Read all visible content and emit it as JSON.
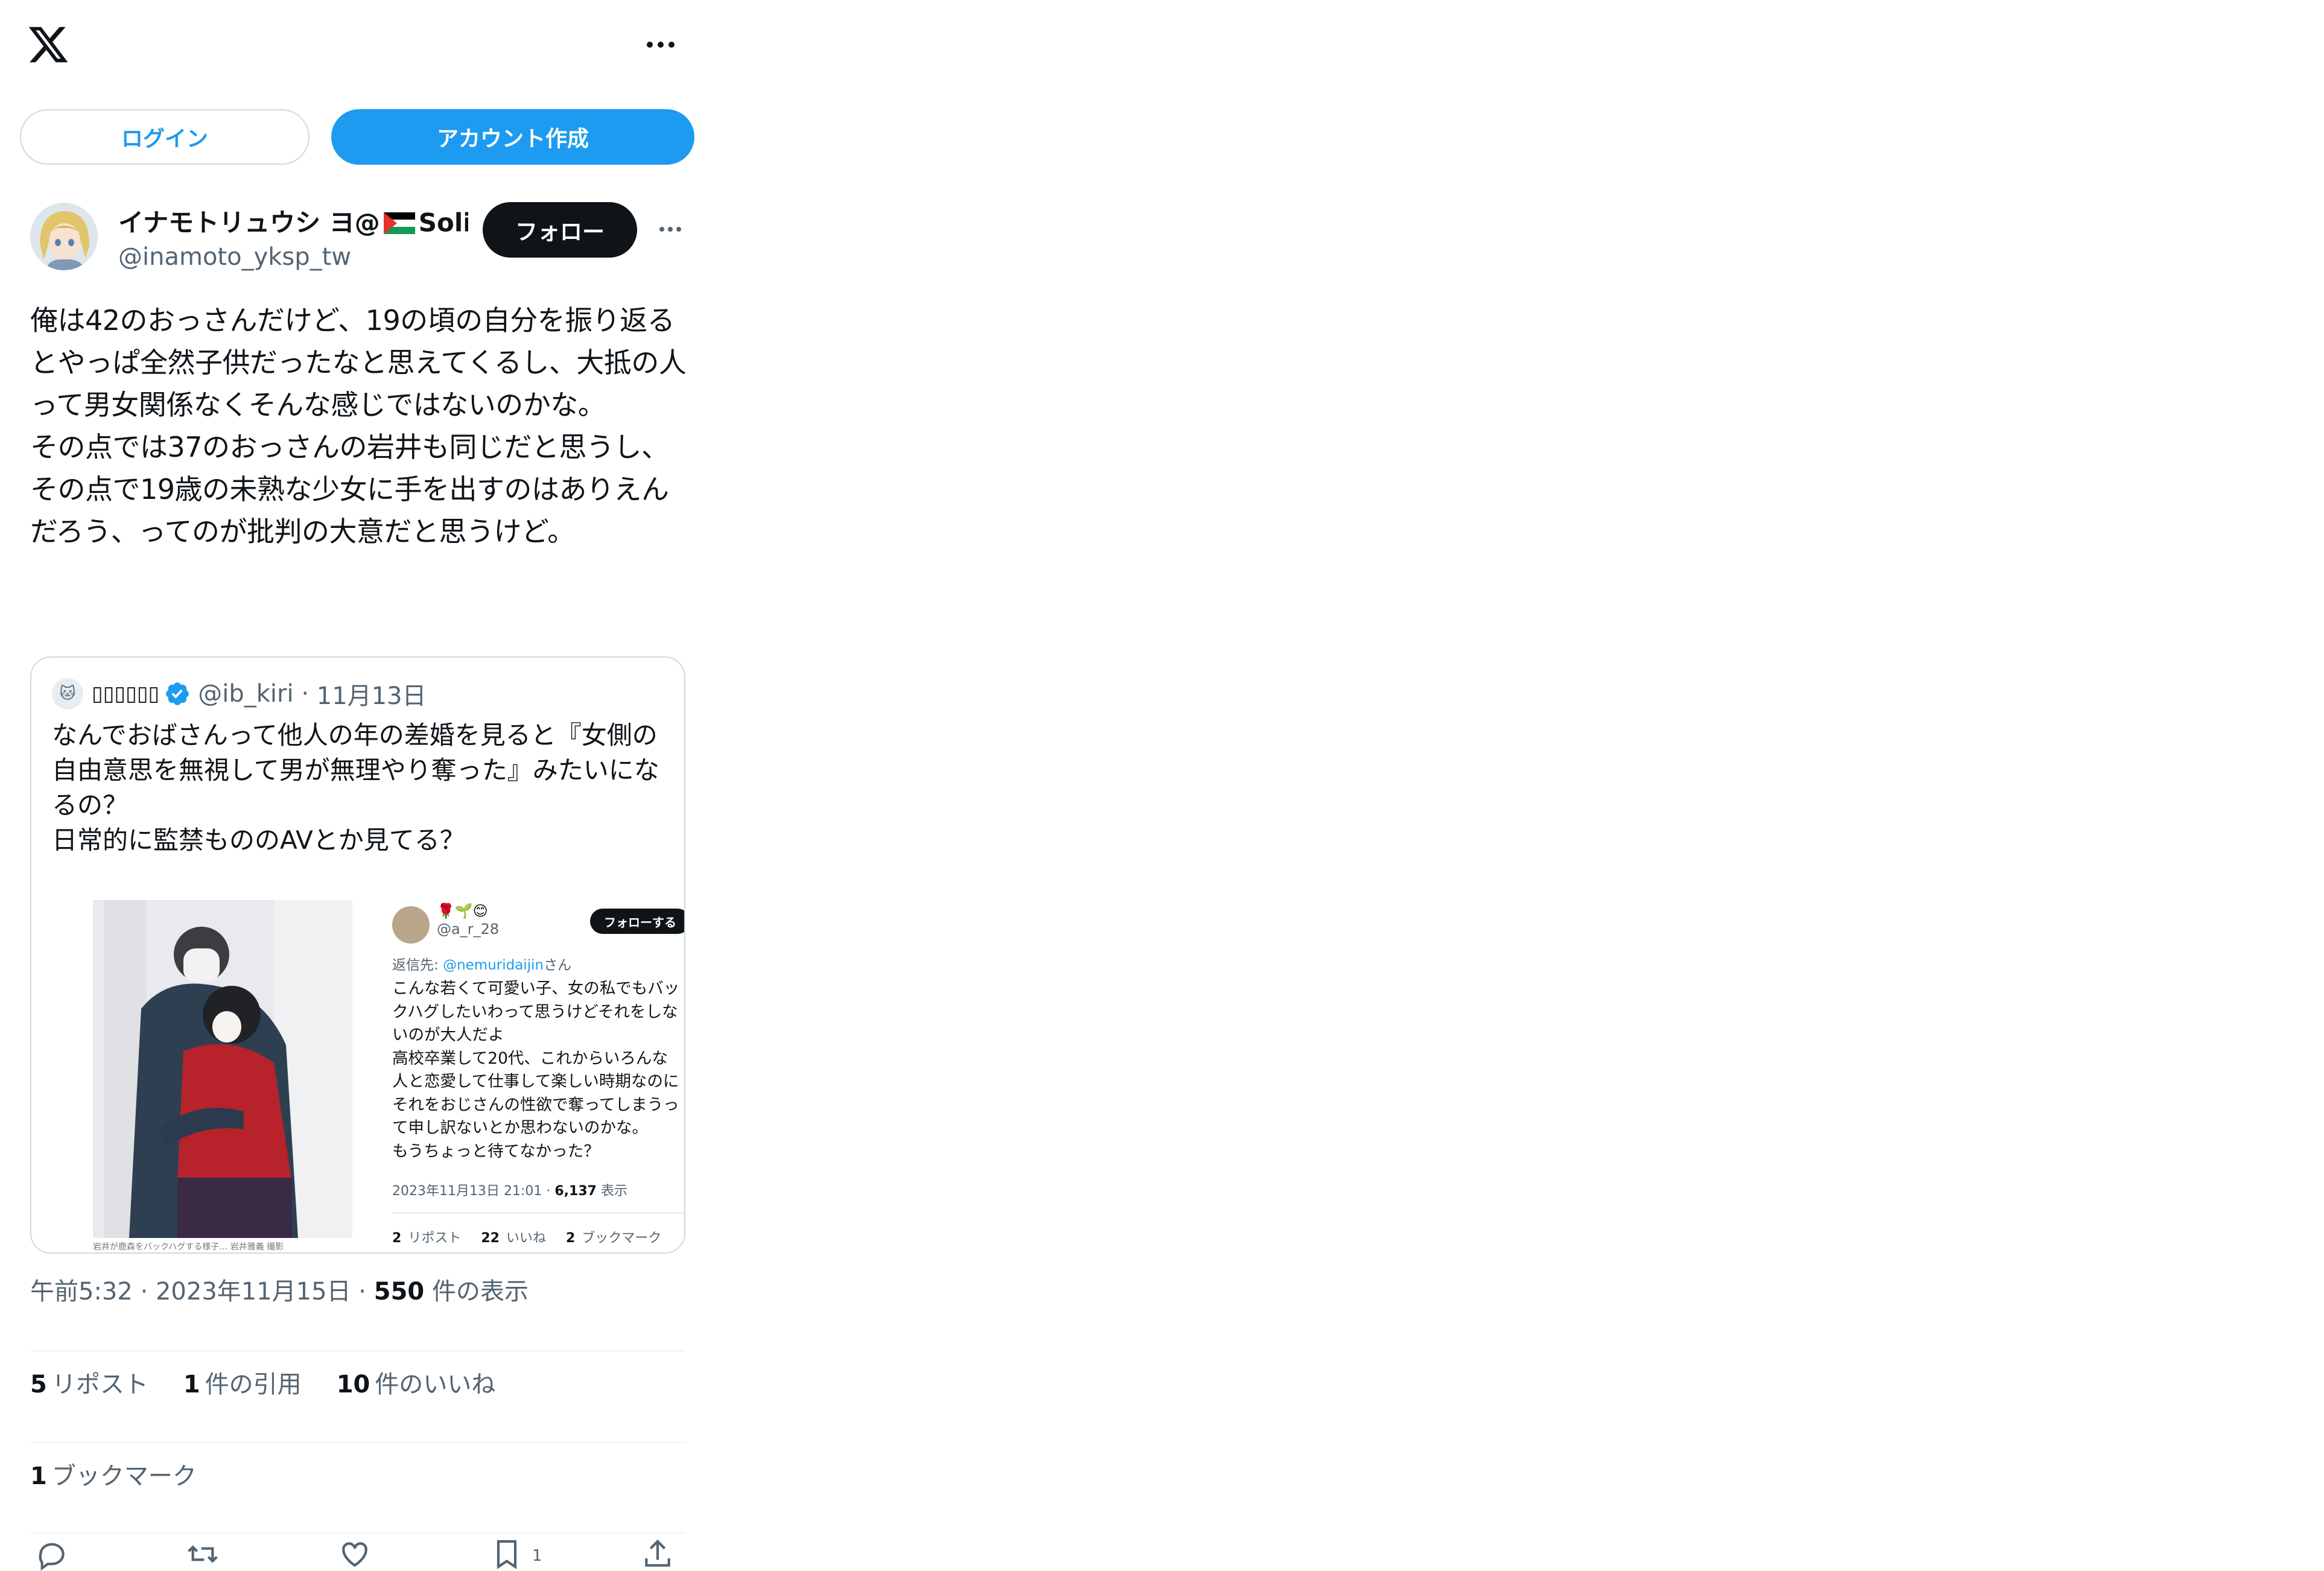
{
  "topbar": {
    "logo": "x-logo-icon",
    "more": "more-horizontal-icon"
  },
  "auth": {
    "login_label": "ログイン",
    "signup_label": "アカウント作成"
  },
  "post": {
    "display_name_prefix": "イナモトリュウシ ヨ@",
    "display_name_suffix": "Solid",
    "handle": "@inamoto_yksp_tw",
    "follow_label": "フォロー",
    "text": "俺は42のおっさんだけど、19の頃の自分を振り返るとやっぱ全然子供だったなと思えてくるし、大抵の人って男女関係なくそんな感じではないのかな。\nその点では37のおっさんの岩井も同じだと思うし、その点で19歳の未熟な少女に手を出すのはありえんだろう、ってのが批判の大意だと思うけど。",
    "time": "午前5:32",
    "date": "2023年11月15日",
    "views_count": "550",
    "views_label": "件の表示",
    "reposts_count": "5",
    "reposts_label": "リポスト",
    "quotes_count": "1",
    "quotes_label": "件の引用",
    "likes_count": "10",
    "likes_label": "件のいいね",
    "bookmarks_count": "1",
    "bookmarks_label": "ブックマーク",
    "bookmark_action_count": "1"
  },
  "quote": {
    "name": "▯▯▯▯▯▯",
    "handle": "@ib_kiri",
    "date": "11月13日",
    "text": "なんでおばさんって他人の年の差婚を見ると『女側の自由意思を無視して男が無理やり奪った』みたいになるの？\n日常的に監禁もののAVとか見てる？",
    "media": {
      "reply_emoji": "🌹🌱😊",
      "reply_handle": "@a_r_28",
      "reply_follow": "フォローする",
      "reply_to_prefix": "返信先: ",
      "reply_to_handle": "@nemuridaijin",
      "reply_to_suffix": "さん",
      "reply_text": "こんな若くて可愛い子、女の私でもバックハグしたいわって思うけどそれをしないのが大人だよ\n高校卒業して20代、これからいろんな人と恋愛して仕事して楽しい時期なのにそれをおじさんの性欲で奪ってしまうって申し訳ないとか思わないのかな。\nもうちょっと待てなかった？",
      "reply_datetime": "2023年11月13日 21:01 · ",
      "reply_views": "6,137",
      "reply_views_label": " 表示",
      "reply_reposts": "2",
      "reply_reposts_label": "リポスト",
      "reply_likes": "22",
      "reply_likes_label": "いいね",
      "reply_bookmarks": "2",
      "reply_bookmarks_label": "ブックマーク",
      "photo_caption": "岩井が鹿森をバックハグする様子… 岩井雅義 撮影"
    }
  },
  "colors": {
    "accent": "#1d9bf0",
    "text": "#0f1419",
    "muted": "#536471",
    "border": "#cfd9de"
  }
}
